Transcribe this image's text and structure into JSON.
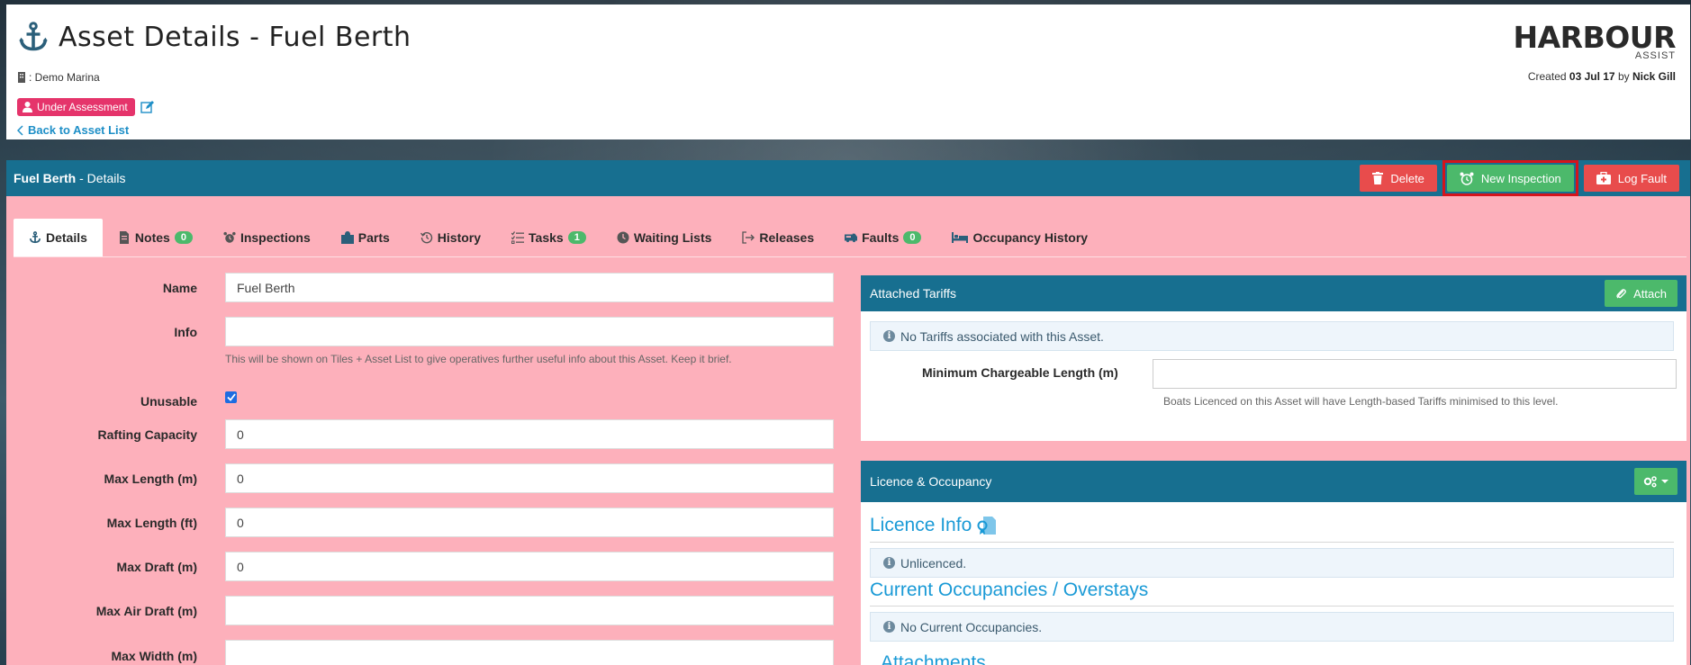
{
  "header": {
    "title": "Asset Details - Fuel Berth",
    "marina": ": Demo Marina",
    "status": "Under Assessment",
    "back_link": "Back to Asset List",
    "logo": "HARBOUR",
    "logo_sub": "ASSIST",
    "created_prefix": "Created",
    "created_date": "03 Jul 17",
    "created_by_prefix": "by",
    "created_by": "Nick Gill"
  },
  "section_bar": {
    "asset_name": "Fuel Berth",
    "suffix": " - Details",
    "buttons": {
      "delete": "Delete",
      "new_inspection": "New Inspection",
      "log_fault": "Log Fault"
    }
  },
  "tabs": [
    {
      "label": "Details",
      "icon": "anchor-icon",
      "active": true
    },
    {
      "label": "Notes",
      "icon": "document-icon",
      "badge": "0"
    },
    {
      "label": "Inspections",
      "icon": "alarm-clock-icon"
    },
    {
      "label": "Parts",
      "icon": "puzzle-icon"
    },
    {
      "label": "History",
      "icon": "history-icon"
    },
    {
      "label": "Tasks",
      "icon": "tasks-list-icon",
      "badge": "1"
    },
    {
      "label": "Waiting Lists",
      "icon": "clock-icon"
    },
    {
      "label": "Releases",
      "icon": "sign-out-icon"
    },
    {
      "label": "Faults",
      "icon": "ambulance-icon",
      "badge": "0"
    },
    {
      "label": "Occupancy History",
      "icon": "bed-icon"
    }
  ],
  "form": {
    "name_label": "Name",
    "name_value": "Fuel Berth",
    "info_label": "Info",
    "info_value": "",
    "info_help": "This will be shown on Tiles + Asset List to give operatives further useful info about this Asset. Keep it brief.",
    "unusable_label": "Unusable",
    "unusable_checked": true,
    "rafting_label": "Rafting Capacity",
    "rafting_value": "0",
    "maxlen_m_label": "Max Length (m)",
    "maxlen_m_value": "0",
    "maxlen_ft_label": "Max Length (ft)",
    "maxlen_ft_value": "0",
    "maxdraft_label": "Max Draft (m)",
    "maxdraft_value": "0",
    "maxair_label": "Max Air Draft (m)",
    "maxair_value": "",
    "maxwidth_label": "Max Width (m)"
  },
  "tariffs": {
    "title": "Attached Tariffs",
    "attach_button": "Attach",
    "info": "No Tariffs associated with this Asset.",
    "min_len_label": "Minimum Chargeable Length (m)",
    "min_len_value": "",
    "min_len_help": "Boats Licenced on this Asset will have Length-based Tariffs minimised to this level."
  },
  "licence": {
    "title": "Licence & Occupancy",
    "licence_heading": "Licence Info",
    "licence_info": "Unlicenced.",
    "occupancy_heading": "Current Occupancies / Overstays",
    "occupancy_info": "No Current Occupancies.",
    "attachments_heading": "Attachments"
  },
  "colors": {
    "bar_blue": "#176f90",
    "pink_bg": "#fdb0bb",
    "green": "#4cb96b",
    "red": "#e84c4c",
    "badge_pink": "#e5346b",
    "link_blue": "#1a9ad6"
  }
}
